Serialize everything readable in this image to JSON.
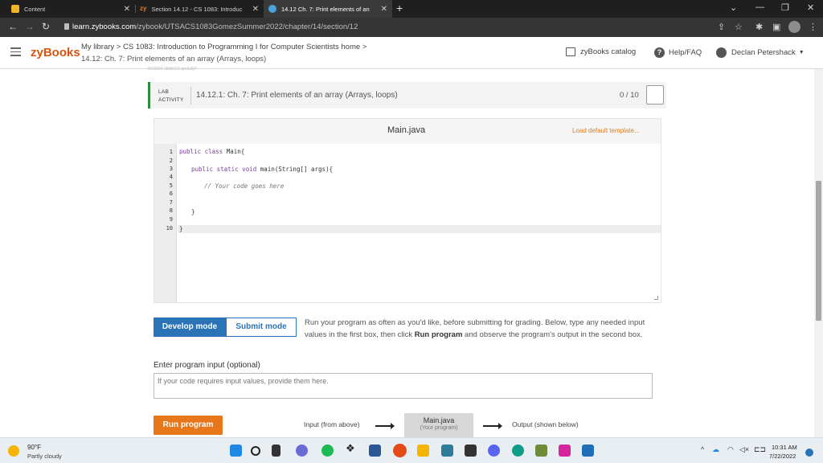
{
  "browser": {
    "tabs": [
      {
        "label": "Content",
        "active": false
      },
      {
        "label": "Section 14.12 - CS 1083: Introduc",
        "active": false
      },
      {
        "label": "14.12 Ch. 7: Print elements of an",
        "active": true
      }
    ],
    "url_host": "learn.zybooks.com",
    "url_path": "/zybook/UTSACS1083GomezSummer2022/chapter/14/section/12",
    "colors": {
      "tabstrip": "#1f1f1f",
      "addrbar": "#353535"
    }
  },
  "header": {
    "logo": "zyBooks",
    "breadcrumb_line1": "My library > CS 1083: Introduction to Programming I for Computer Scientists home >",
    "breadcrumb_line2": "14.12: Ch. 7: Print elements of an array (Arrays, loops)",
    "catalog": "zyBooks catalog",
    "help": "Help/FAQ",
    "user": "Declan Petershack",
    "ghost_text": "4015924-28d5022-qm3u5jY",
    "brand_color": "#d9530f"
  },
  "lab": {
    "tag_line1": "LAB",
    "tag_line2": "ACTIVITY",
    "title": "14.12.1: Ch. 7: Print elements of an array (Arrays, loops)",
    "score": "0 / 10"
  },
  "editor": {
    "filename": "Main.java",
    "load_default": "Load default template...",
    "line_numbers": [
      "1",
      "2",
      "3",
      "4",
      "5",
      "6",
      "7",
      "8",
      "9",
      "10"
    ],
    "lines": {
      "l1_kw": "public class",
      "l1_rest": " Main{",
      "l3_kw": "public static void",
      "l3_rest": " main(String[] args){",
      "l5_comment": "// Your code goes here",
      "l8": "}",
      "l10": "}"
    }
  },
  "modes": {
    "develop": "Develop mode",
    "submit": "Submit mode",
    "desc_part1": "Run your program as often as you'd like, before submitting for grading. Below, type any needed input values in the first box, then click ",
    "desc_bold": "Run program",
    "desc_part2": " and observe the program's output in the second box."
  },
  "input": {
    "label": "Enter program input (optional)",
    "placeholder": "If your code requires input values, provide them here."
  },
  "run": {
    "button": "Run program",
    "input_label": "Input (from above)",
    "main_title": "Main.java",
    "main_sub": "(Your program)",
    "output_label": "Output (shown below)"
  },
  "taskbar": {
    "temp": "90°F",
    "weather": "Partly cloudy",
    "time": "10:31 AM",
    "date": "7/22/2022"
  }
}
